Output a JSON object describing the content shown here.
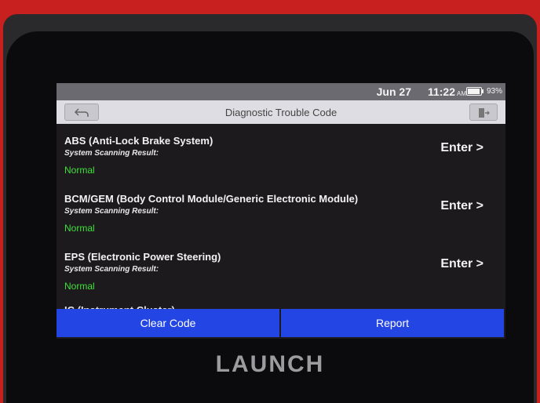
{
  "status": {
    "date": "Jun 27",
    "time": "11:22",
    "ampm": "AM",
    "battery_pct": "93%",
    "battery_level": 0.93
  },
  "header": {
    "title": "Diagnostic Trouble Code"
  },
  "systems": [
    {
      "name": "ABS (Anti-Lock Brake System)",
      "result_label": "System Scanning Result:",
      "status": "Normal",
      "action": "Enter >"
    },
    {
      "name": "BCM/GEM (Body Control Module/Generic Electronic Module)",
      "result_label": "System Scanning Result:",
      "status": "Normal",
      "action": "Enter >"
    },
    {
      "name": "EPS (Electronic Power Steering)",
      "result_label": "System Scanning Result:",
      "status": "Normal",
      "action": "Enter >"
    },
    {
      "name": "IC (Instrument Cluster)"
    }
  ],
  "footer": {
    "clear_label": "Clear Code",
    "report_label": "Report"
  },
  "brand": "LAUNCH",
  "colors": {
    "status_ok": "#3fe03a",
    "button_blue": "#2345e4"
  },
  "icons": {
    "back": "back-arrow-icon",
    "exit": "exit-icon"
  }
}
